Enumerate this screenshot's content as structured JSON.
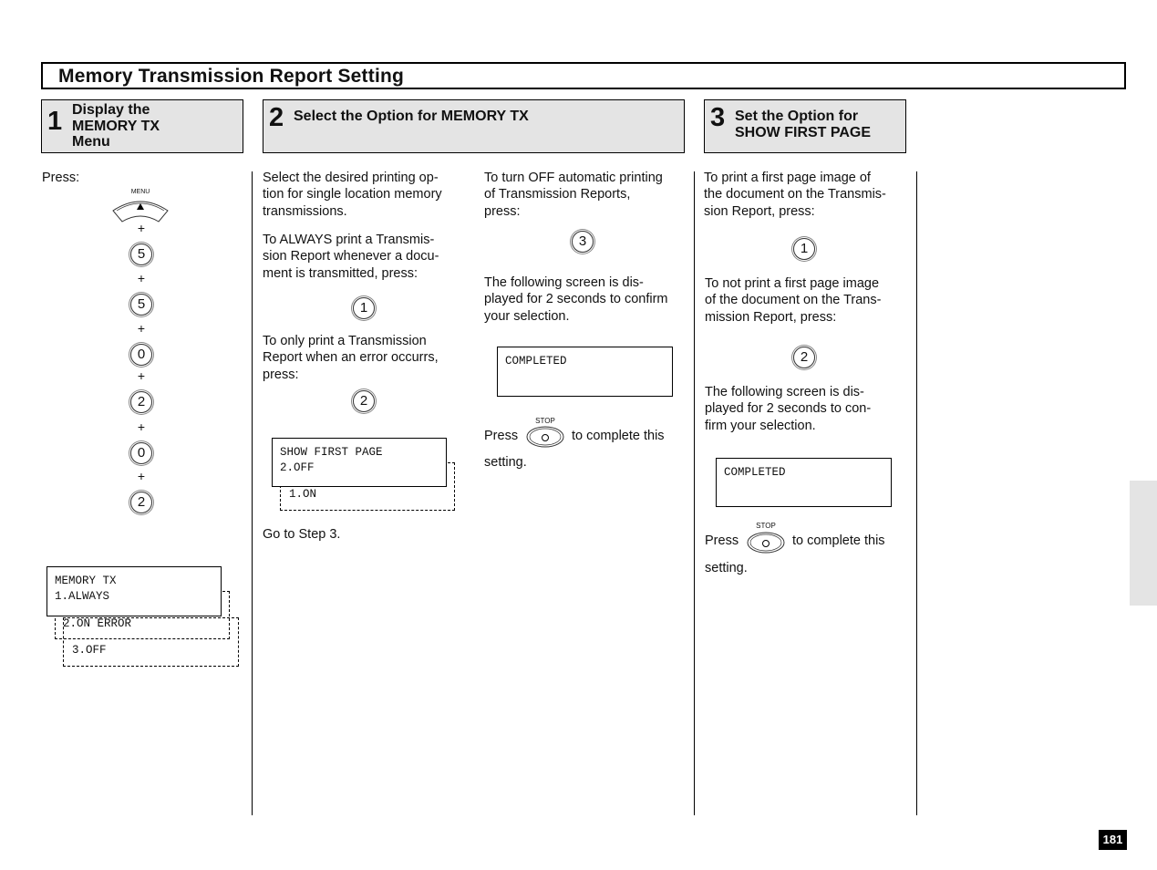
{
  "page": {
    "title": "Memory Transmission Report Setting",
    "page_number": "181"
  },
  "steps": [
    {
      "number": "1",
      "label_lines": [
        "Display the",
        "MEMORY TX",
        "Menu"
      ]
    },
    {
      "number": "2",
      "label_lines": [
        "Select the Option for MEMORY TX"
      ]
    },
    {
      "number": "3",
      "label_lines": [
        "Set the Option for",
        "SHOW FIRST PAGE"
      ]
    }
  ],
  "col1": {
    "press_label": "Press:",
    "menu_key_label": "MENU",
    "key_sequence": [
      "5",
      "5",
      "0",
      "2",
      "0",
      "2"
    ],
    "plus": "+",
    "lcd": {
      "line1": "MEMORY TX",
      "line2": "1.ALWAYS",
      "opt2": "2.ON ERROR",
      "opt3": "3.OFF"
    }
  },
  "col2": {
    "intro": "Select the desired printing op-\ntion for single location memory\ntransmissions.",
    "always_text": "To ALWAYS print a Transmis-\nsion Report whenever a docu-\nment is transmitted, press:",
    "always_key": "1",
    "error_text": "To only print a Transmission\nReport when an error occurrs,\npress:",
    "error_key": "2",
    "lcd": {
      "line1": "SHOW FIRST PAGE",
      "line2": "2.OFF",
      "opt1": "1.ON"
    },
    "goto": "Go to Step 3."
  },
  "col3": {
    "off_text": "To turn OFF automatic printing\nof Transmission Reports,\npress:",
    "off_key": "3",
    "confirm_text": "The following screen is dis-\nplayed for 2 seconds to confirm\nyour selection.",
    "lcd": "COMPLETED",
    "press": "Press",
    "stop_label": "STOP",
    "complete": "to complete this",
    "setting": "setting."
  },
  "col4": {
    "print_text": "To print a first page image of\nthe document on the Transmis-\nsion Report, press:",
    "print_key": "1",
    "noprint_text": "To not print a first page image\nof the document on the Trans-\nmission Report, press:",
    "noprint_key": "2",
    "confirm_text": "The following screen is dis-\nplayed for 2 seconds to con-\nfirm your selection.",
    "lcd": "COMPLETED",
    "press": "Press",
    "stop_label": "STOP",
    "complete": "to complete this",
    "setting": "setting."
  }
}
